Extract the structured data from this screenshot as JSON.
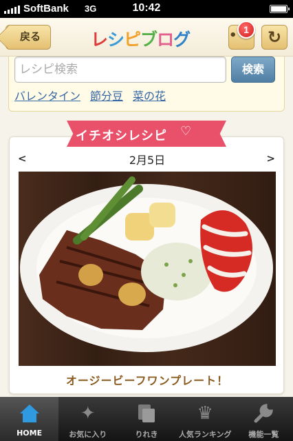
{
  "status_bar": {
    "carrier": "SoftBank",
    "network": "3G",
    "time": "10:42"
  },
  "nav": {
    "back_label": "戻る",
    "logo_parts": [
      "レ",
      "シ",
      "ピ",
      "ブ",
      "ロ",
      "グ"
    ],
    "menu_label": "•••",
    "badge_count": "1",
    "reload_icon": "reload-icon"
  },
  "search": {
    "placeholder": "レシピ検索",
    "button_label": "検索",
    "keywords": [
      "バレンタイン",
      "節分豆",
      "菜の花"
    ]
  },
  "featured": {
    "ribbon_label": "イチオシレシピ",
    "prev_label": "<",
    "next_label": ">",
    "date": "2月5日",
    "recipe_title": "オージービーフワンプレート！"
  },
  "tabs": [
    {
      "label": "HOME",
      "icon": "home-icon",
      "active": true
    },
    {
      "label": "お気に入り",
      "icon": "sparkle-icon",
      "active": false
    },
    {
      "label": "りれき",
      "icon": "history-icon",
      "active": false
    },
    {
      "label": "人気ランキング",
      "icon": "crown-icon",
      "active": false
    },
    {
      "label": "機能一覧",
      "icon": "wrench-icon",
      "active": false
    }
  ],
  "colors": {
    "ribbon": "#e9506a",
    "search_button": "#4f7ea4",
    "link": "#3465a4",
    "recipe_title": "#8a5a1e",
    "tab_active_icon": "#2f9ae0"
  }
}
